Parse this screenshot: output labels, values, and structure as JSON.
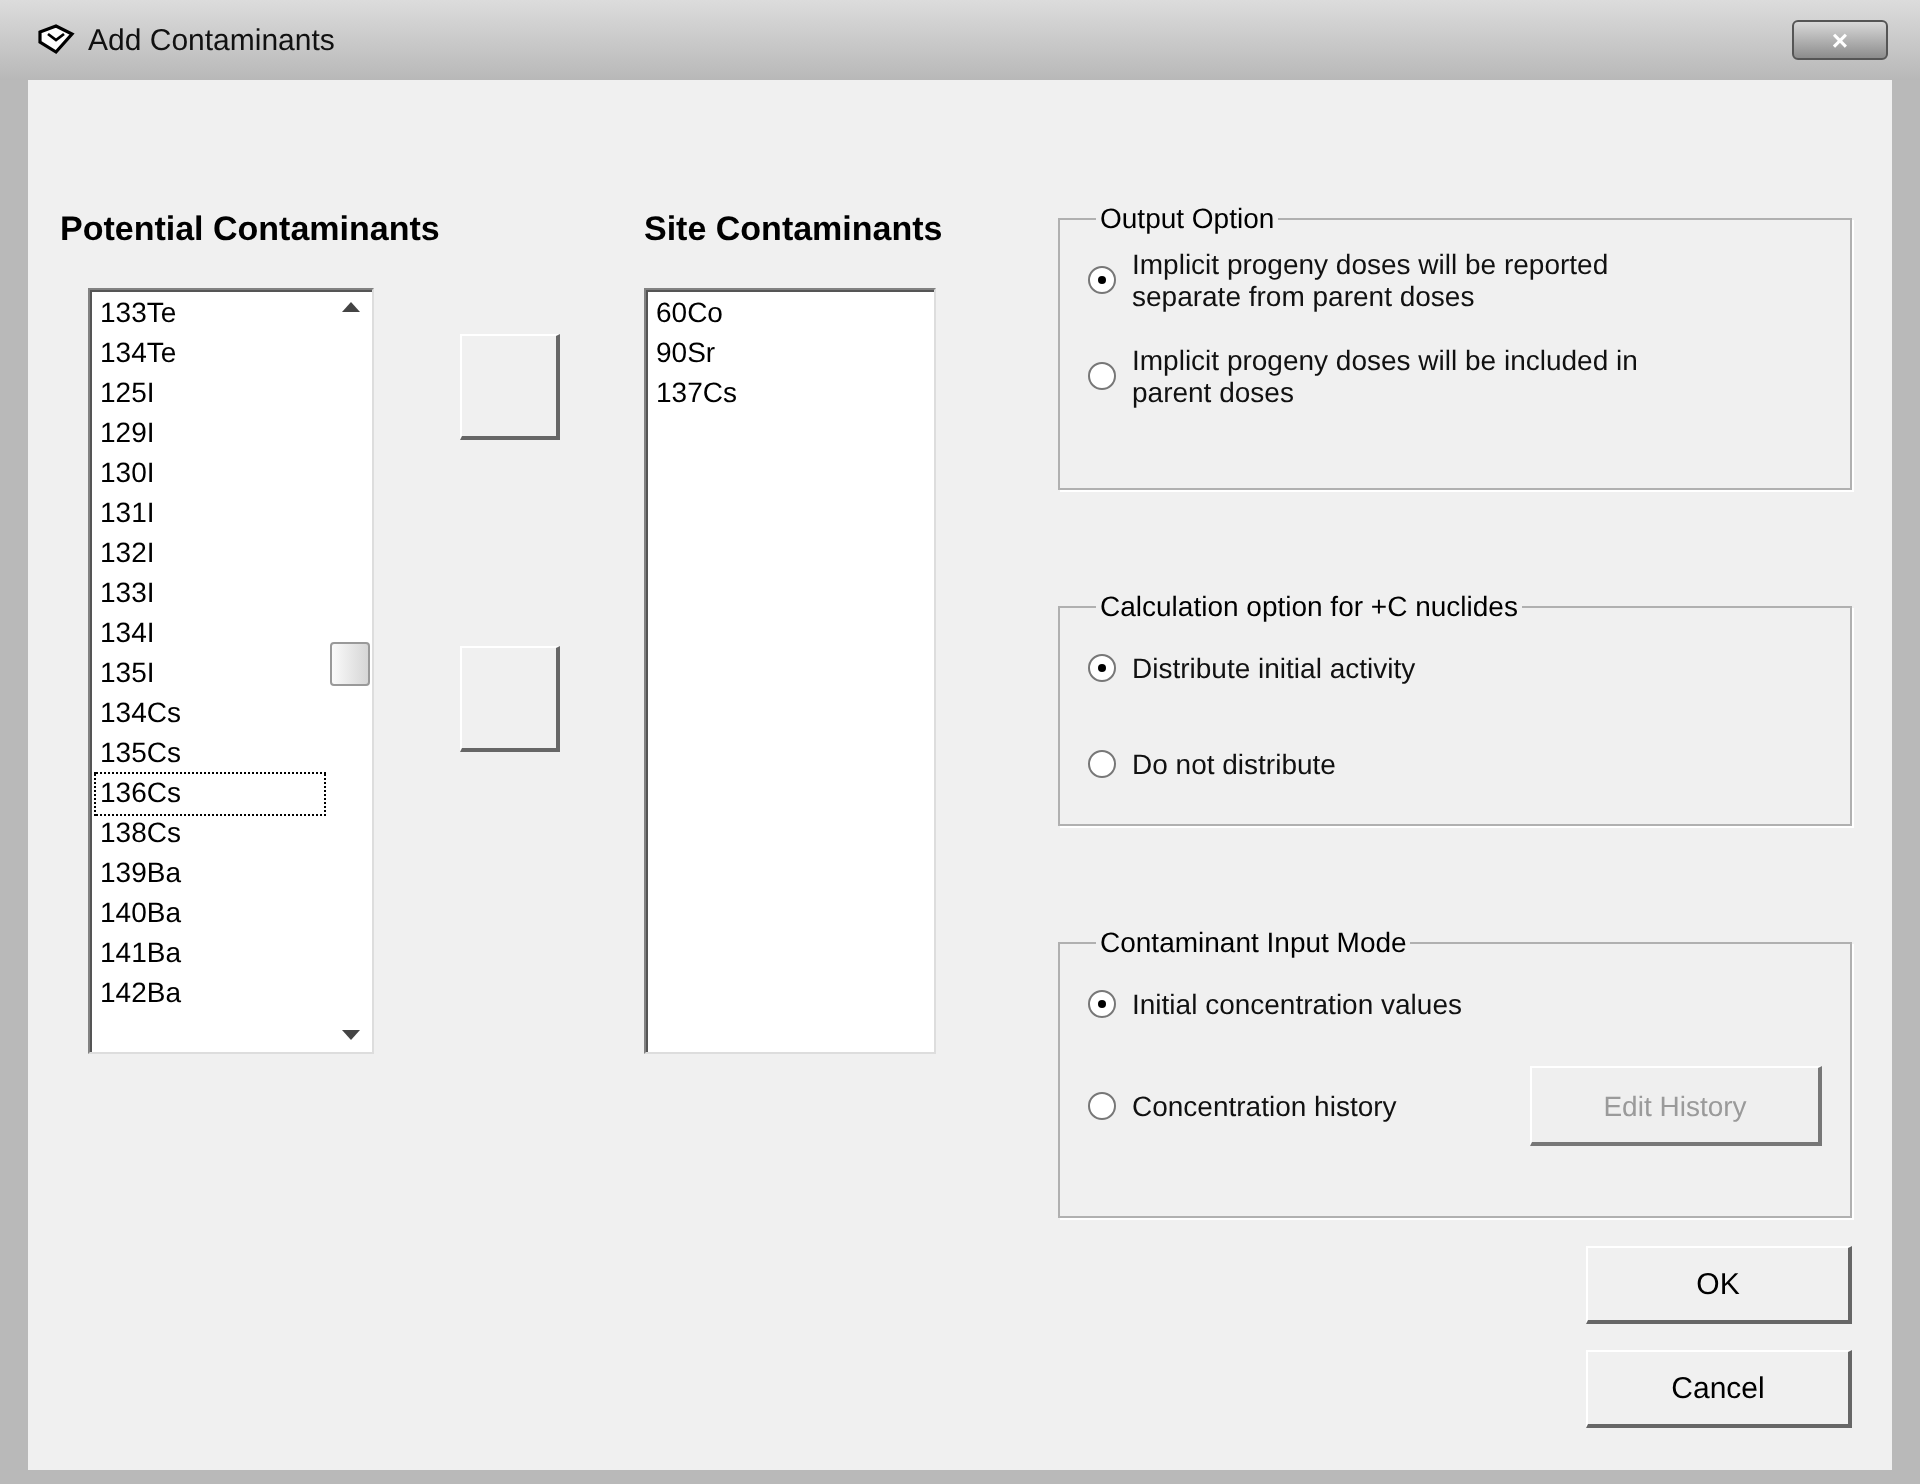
{
  "window": {
    "title": "Add Contaminants",
    "close": "×"
  },
  "potential": {
    "heading": "Potential Contaminants",
    "items": [
      {
        "label": "133Te",
        "focused": false
      },
      {
        "label": "134Te",
        "focused": false
      },
      {
        "label": "125I",
        "focused": false
      },
      {
        "label": "129I",
        "focused": false
      },
      {
        "label": "130I",
        "focused": false
      },
      {
        "label": "131I",
        "focused": false
      },
      {
        "label": "132I",
        "focused": false
      },
      {
        "label": "133I",
        "focused": false
      },
      {
        "label": "134I",
        "focused": false
      },
      {
        "label": "135I",
        "focused": false
      },
      {
        "label": "134Cs",
        "focused": false
      },
      {
        "label": "135Cs",
        "focused": false
      },
      {
        "label": "136Cs",
        "focused": true
      },
      {
        "label": "138Cs",
        "focused": false
      },
      {
        "label": "139Ba",
        "focused": false
      },
      {
        "label": "140Ba",
        "focused": false
      },
      {
        "label": "141Ba",
        "focused": false
      },
      {
        "label": "142Ba",
        "focused": false
      }
    ]
  },
  "site": {
    "heading": "Site Contaminants",
    "items": [
      {
        "label": "60Co"
      },
      {
        "label": "90Sr"
      },
      {
        "label": "137Cs"
      }
    ]
  },
  "groups": [
    {
      "title": "Output Option",
      "options": [
        {
          "label": "Implicit progeny doses will be reported separate from parent doses",
          "selected": true
        },
        {
          "label": "Implicit progeny doses will be included in parent doses",
          "selected": false
        }
      ]
    },
    {
      "title": "Calculation option for +C nuclides",
      "options": [
        {
          "label": "Distribute initial activity",
          "selected": true
        },
        {
          "label": "Do not distribute",
          "selected": false
        }
      ]
    },
    {
      "title": "Contaminant Input Mode",
      "options": [
        {
          "label": "Initial concentration values",
          "selected": true
        },
        {
          "label": "Concentration history",
          "selected": false,
          "button": {
            "label": "Edit History",
            "disabled": true
          }
        }
      ]
    }
  ],
  "buttons": [
    "OK",
    "Cancel"
  ]
}
